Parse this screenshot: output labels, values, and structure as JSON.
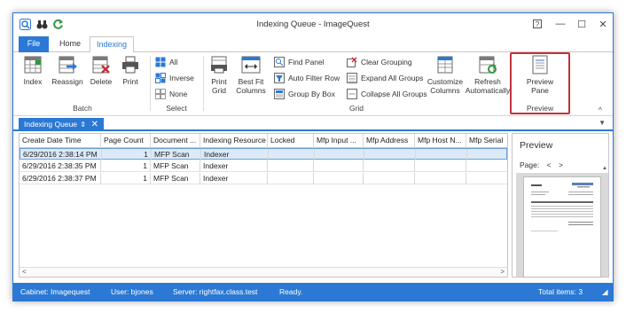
{
  "window": {
    "title": "Indexing Queue - ImageQuest"
  },
  "title_controls": {
    "help": "?",
    "minimize": "—",
    "maximize": "☐",
    "close": "✕"
  },
  "tabs": {
    "file": "File",
    "home": "Home",
    "indexing": "Indexing"
  },
  "ribbon": {
    "batch": {
      "index": "Index",
      "reassign": "Reassign",
      "delete": "Delete",
      "print": "Print",
      "label": "Batch"
    },
    "select": {
      "all": "All",
      "inverse": "Inverse",
      "none": "None",
      "label": "Select"
    },
    "grid": {
      "print_grid_1": "Print",
      "print_grid_2": "Grid",
      "best_fit_1": "Best Fit",
      "best_fit_2": "Columns",
      "find_panel": "Find Panel",
      "auto_filter_row": "Auto Filter Row",
      "group_by_box": "Group By Box",
      "clear_grouping": "Clear Grouping",
      "expand_all": "Expand All Groups",
      "collapse_all": "Collapse All Groups",
      "customize_1": "Customize",
      "customize_2": "Columns",
      "refresh_1": "Refresh",
      "refresh_2": "Automatically",
      "label": "Grid"
    },
    "preview": {
      "pane_1": "Preview",
      "pane_2": "Pane",
      "label": "Preview"
    }
  },
  "doc_tab": {
    "label": "Indexing Queue",
    "pin": "⇕",
    "close": "✕"
  },
  "grid": {
    "columns": [
      "Create Date Time",
      "Page Count",
      "Document ...",
      "Indexing Resource",
      "Locked",
      "Mfp Input ...",
      "Mfp Address",
      "Mfp Host N...",
      "Mfp Serial"
    ],
    "rows": [
      {
        "created": "6/29/2016 2:38:14 PM",
        "pages": "1",
        "doc": "MFP Scan",
        "resource": "Indexer"
      },
      {
        "created": "6/29/2016 2:38:35 PM",
        "pages": "1",
        "doc": "MFP Scan",
        "resource": "Indexer"
      },
      {
        "created": "6/29/2016 2:38:37 PM",
        "pages": "1",
        "doc": "MFP Scan",
        "resource": "Indexer"
      }
    ]
  },
  "preview_pane": {
    "title": "Preview",
    "page_label": "Page:",
    "prev": "<",
    "next": ">"
  },
  "status": {
    "cabinet": "Cabinet: Imagequest",
    "user": "User: bjones",
    "server": "Server: rightfax.class.test",
    "state": "Ready.",
    "total": "Total items: 3"
  },
  "colors": {
    "accent": "#2b79d4",
    "highlight": "#c0343a",
    "selected_row": "#dce9f7"
  }
}
